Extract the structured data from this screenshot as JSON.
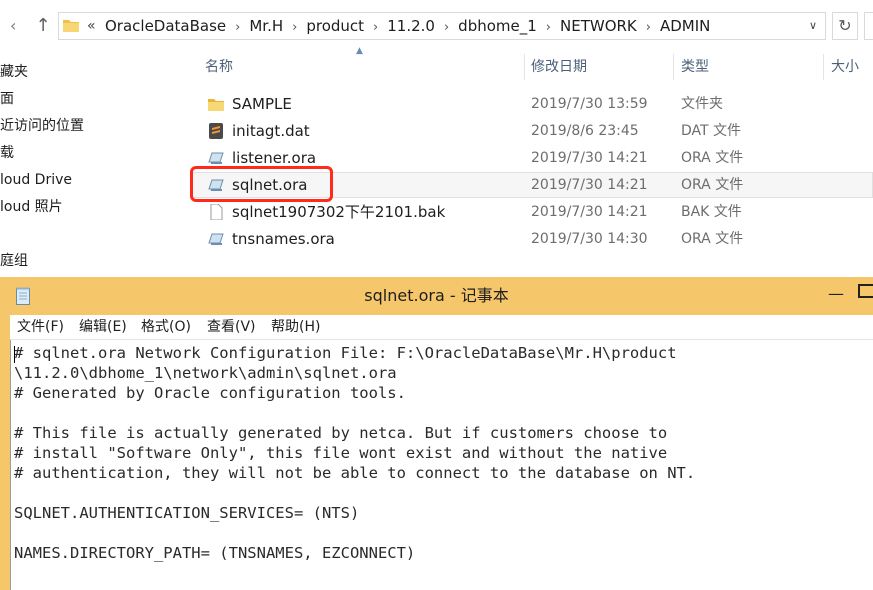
{
  "address": {
    "chevrons": "«",
    "crumbs": [
      "OracleDataBase",
      "Mr.H",
      "product",
      "11.2.0",
      "dbhome_1",
      "NETWORK",
      "ADMIN"
    ]
  },
  "nav_pane": {
    "items": [
      "藏夹",
      "面",
      "近访问的位置",
      "载",
      "loud Drive",
      "loud 照片",
      "庭组"
    ]
  },
  "columns": {
    "name": "名称",
    "date": "修改日期",
    "type": "类型",
    "size": "大小"
  },
  "files": [
    {
      "name": "SAMPLE",
      "date": "2019/7/30 13:59",
      "type": "文件夹",
      "icon": "folder-icon"
    },
    {
      "name": "initagt.dat",
      "date": "2019/8/6 23:45",
      "type": "DAT 文件",
      "icon": "sublime-file-icon"
    },
    {
      "name": "listener.ora",
      "date": "2019/7/30 14:21",
      "type": "ORA 文件",
      "icon": "ora-file-icon"
    },
    {
      "name": "sqlnet.ora",
      "date": "2019/7/30 14:21",
      "type": "ORA 文件",
      "icon": "ora-file-icon"
    },
    {
      "name": "sqlnet1907302下午2101.bak",
      "date": "2019/7/30 14:21",
      "type": "BAK 文件",
      "icon": "blank-file-icon"
    },
    {
      "name": "tnsnames.ora",
      "date": "2019/7/30 14:30",
      "type": "ORA 文件",
      "icon": "ora-file-icon"
    }
  ],
  "notepad": {
    "title": "sqlnet.ora - 记事本",
    "menu": [
      "文件(F)",
      "编辑(E)",
      "格式(O)",
      "查看(V)",
      "帮助(H)"
    ],
    "content": "# sqlnet.ora Network Configuration File: F:\\OracleDataBase\\Mr.H\\product\n\\11.2.0\\dbhome_1\\network\\admin\\sqlnet.ora\n# Generated by Oracle configuration tools.\n\n# This file is actually generated by netca. But if customers choose to\n# install \"Software Only\", this file wont exist and without the native\n# authentication, they will not be able to connect to the database on NT.\n\nSQLNET.AUTHENTICATION_SERVICES= (NTS)\n\nNAMES.DIRECTORY_PATH= (TNSNAMES, EZCONNECT)"
  },
  "colors": {
    "highlight_box": "#ff2a1a",
    "notepad_frame": "#f6c66b",
    "header_text": "#4c607a"
  }
}
